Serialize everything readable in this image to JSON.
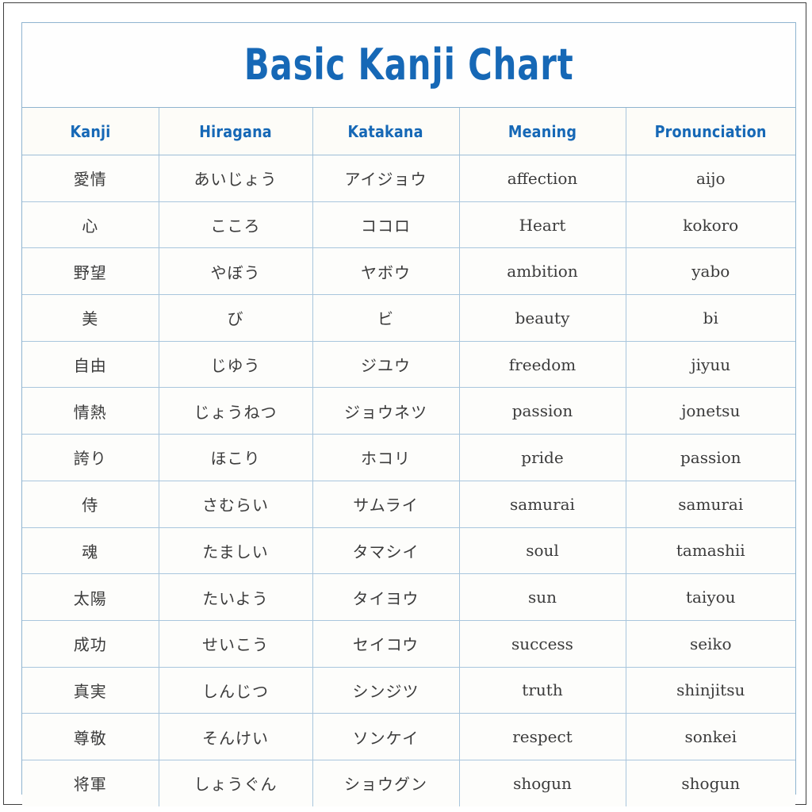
{
  "title": "Basic Kanji Chart",
  "colors": {
    "accent_blue": "#1668b6",
    "border_blue": "#a9c6dd",
    "outer_frame": "#3f3f3f",
    "text_gray": "#3b3b3b",
    "background": "#fdfdfb"
  },
  "columns": [
    {
      "key": "kanji",
      "label": "Kanji"
    },
    {
      "key": "hiragana",
      "label": "Hiragana"
    },
    {
      "key": "katakana",
      "label": "Katakana"
    },
    {
      "key": "meaning",
      "label": "Meaning"
    },
    {
      "key": "pronunciation",
      "label": "Pronunciation"
    }
  ],
  "rows": [
    {
      "kanji": "愛情",
      "hiragana": "あいじょう",
      "katakana": "アイジョウ",
      "meaning": "affection",
      "pronunciation": "aijo"
    },
    {
      "kanji": "心",
      "hiragana": "こころ",
      "katakana": "ココロ",
      "meaning": "Heart",
      "pronunciation": "kokoro"
    },
    {
      "kanji": "野望",
      "hiragana": "やぼう",
      "katakana": "ヤボウ",
      "meaning": "ambition",
      "pronunciation": "yabo"
    },
    {
      "kanji": "美",
      "hiragana": "び",
      "katakana": "ビ",
      "meaning": "beauty",
      "pronunciation": "bi"
    },
    {
      "kanji": "自由",
      "hiragana": "じゆう",
      "katakana": "ジユウ",
      "meaning": "freedom",
      "pronunciation": "jiyuu"
    },
    {
      "kanji": "情熱",
      "hiragana": "じょうねつ",
      "katakana": "ジョウネツ",
      "meaning": "passion",
      "pronunciation": "jonetsu"
    },
    {
      "kanji": "誇り",
      "hiragana": "ほこり",
      "katakana": "ホコリ",
      "meaning": "pride",
      "pronunciation": "passion"
    },
    {
      "kanji": "侍",
      "hiragana": "さむらい",
      "katakana": "サムライ",
      "meaning": "samurai",
      "pronunciation": "samurai"
    },
    {
      "kanji": "魂",
      "hiragana": "たましい",
      "katakana": "タマシイ",
      "meaning": "soul",
      "pronunciation": "tamashii"
    },
    {
      "kanji": "太陽",
      "hiragana": "たいよう",
      "katakana": "タイヨウ",
      "meaning": "sun",
      "pronunciation": "taiyou"
    },
    {
      "kanji": "成功",
      "hiragana": "せいこう",
      "katakana": "セイコウ",
      "meaning": "success",
      "pronunciation": "seiko"
    },
    {
      "kanji": "真実",
      "hiragana": "しんじつ",
      "katakana": "シンジツ",
      "meaning": "truth",
      "pronunciation": "shinjitsu"
    },
    {
      "kanji": "尊敬",
      "hiragana": "そんけい",
      "katakana": "ソンケイ",
      "meaning": "respect",
      "pronunciation": "sonkei"
    },
    {
      "kanji": "将軍",
      "hiragana": "しょうぐん",
      "katakana": "ショウグン",
      "meaning": "shogun",
      "pronunciation": "shogun"
    }
  ]
}
